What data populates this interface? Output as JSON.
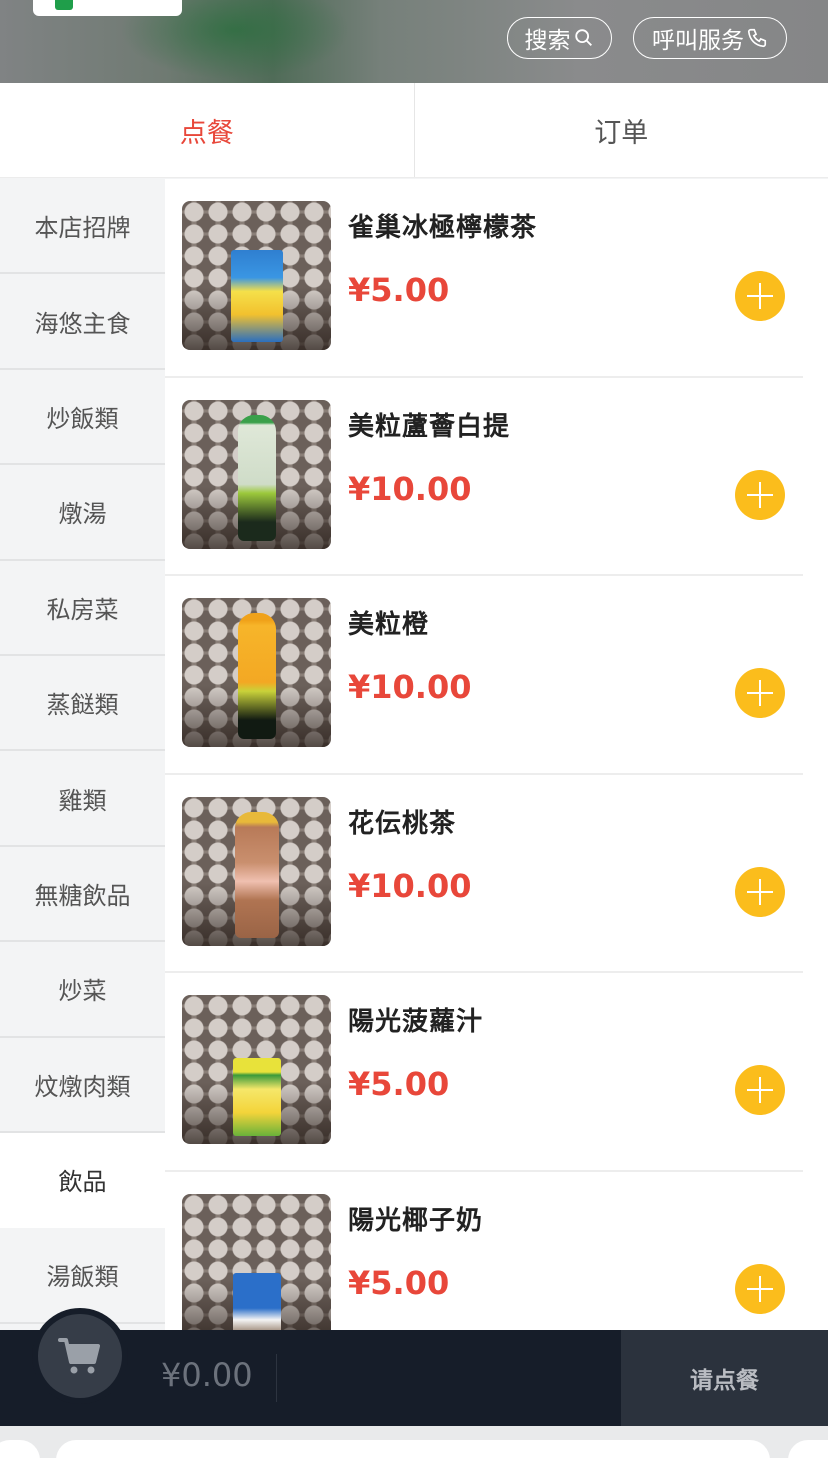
{
  "header": {
    "search_label": "搜索",
    "call_label": "呼叫服务"
  },
  "tabs": [
    {
      "label": "点餐",
      "active": true
    },
    {
      "label": "订单",
      "active": false
    }
  ],
  "categories": [
    {
      "label": "本店招牌"
    },
    {
      "label": "海悠主食"
    },
    {
      "label": "炒飯類"
    },
    {
      "label": "燉湯"
    },
    {
      "label": "私房菜"
    },
    {
      "label": "蒸餸類"
    },
    {
      "label": "雞類"
    },
    {
      "label": "無糖飲品"
    },
    {
      "label": "炒菜"
    },
    {
      "label": "炆燉肉類"
    },
    {
      "label": "飲品",
      "active": true
    },
    {
      "label": "湯飯類"
    }
  ],
  "products": [
    {
      "name": "雀巢冰極檸檬茶",
      "price": "¥5.00",
      "image": "lemon-tea-carton"
    },
    {
      "name": "美粒蘆薈白提",
      "price": "¥10.00",
      "image": "aloe-grape-bottle"
    },
    {
      "name": "美粒橙",
      "price": "¥10.00",
      "image": "orange-bottle"
    },
    {
      "name": "花伝桃茶",
      "price": "¥10.00",
      "image": "peach-tea-bottle"
    },
    {
      "name": "陽光菠蘿汁",
      "price": "¥5.00",
      "image": "pineapple-juice-carton"
    },
    {
      "name": "陽光椰子奶",
      "price": "¥5.00",
      "image": "coconut-milk-carton"
    }
  ],
  "cart": {
    "total": "¥0.00",
    "submit_label": "请点餐"
  },
  "colors": {
    "accent_red": "#e8473a",
    "add_button": "#fbbd1c",
    "cart_bar": "#161d29"
  }
}
